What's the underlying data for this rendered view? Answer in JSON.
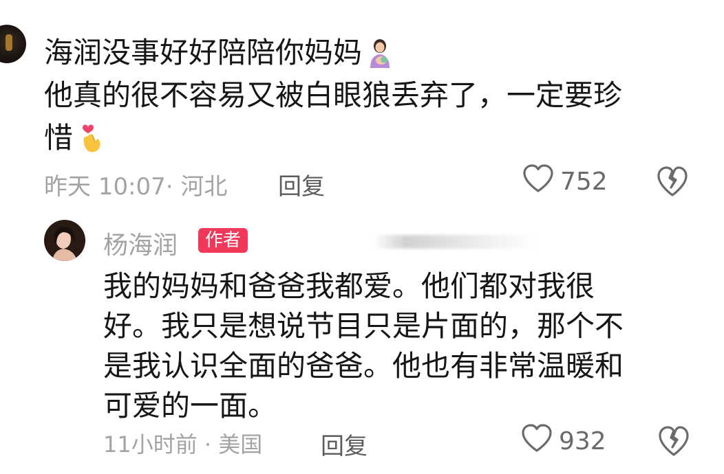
{
  "comment": {
    "lines": [
      "海润没事好好陪陪你妈妈",
      "他真的很不容易又被白眼狼丢弃了，一定要珍",
      "惜"
    ],
    "meta": "昨天 10:07· 河北",
    "reply_label": "回复",
    "like_count": "752"
  },
  "reply": {
    "author": "杨海润",
    "badge": "作者",
    "lines": [
      "我的妈妈和爸爸我都爱。他们都对我很",
      "好。我只是想说节目只是片面的，那个不",
      "是我认识全面的爸爸。他也有非常温暖和",
      "可爱的一面。"
    ],
    "meta": "11小时前 · 美国",
    "reply_label": "回复",
    "like_count": "932"
  },
  "icons": {
    "mother_emoji": "mother-feeding-baby-icon",
    "heart_hands_emoji": "finger-heart-icon",
    "like": "heart-outline-icon",
    "dislike": "broken-heart-icon"
  },
  "colors": {
    "badge": "#f2385a",
    "meta_text": "#a3a3a3",
    "body_text": "#161616"
  }
}
